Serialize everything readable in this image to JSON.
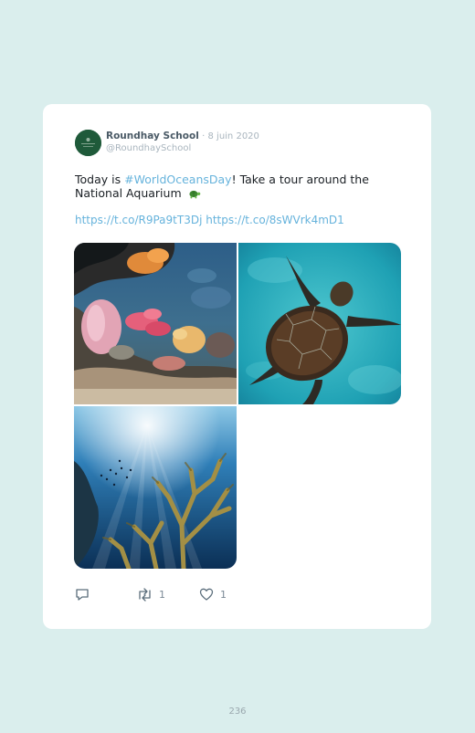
{
  "tweet": {
    "author_name": "Roundhay School",
    "date": "· 8 juin 2020",
    "handle": "@RoundhaySchool",
    "text_before": "Today is ",
    "hashtag": "#WorldOceansDay",
    "text_after": "! Take a tour around the National Aquarium ",
    "emoji_icon": "turtle-emoji",
    "link1": "https://t.co/R9Pa9tT3Dj",
    "link2": "https://t.co/8sWVrk4mD1",
    "photos": [
      "coral-reef-photo",
      "sea-turtle-photo",
      "underwater-coral-photo"
    ],
    "retweet_count": "1",
    "like_count": "1"
  },
  "page_number": "236",
  "colors": {
    "background": "#daeeed",
    "card": "#ffffff",
    "link": "#66b3dc",
    "muted": "#a9b5be"
  }
}
